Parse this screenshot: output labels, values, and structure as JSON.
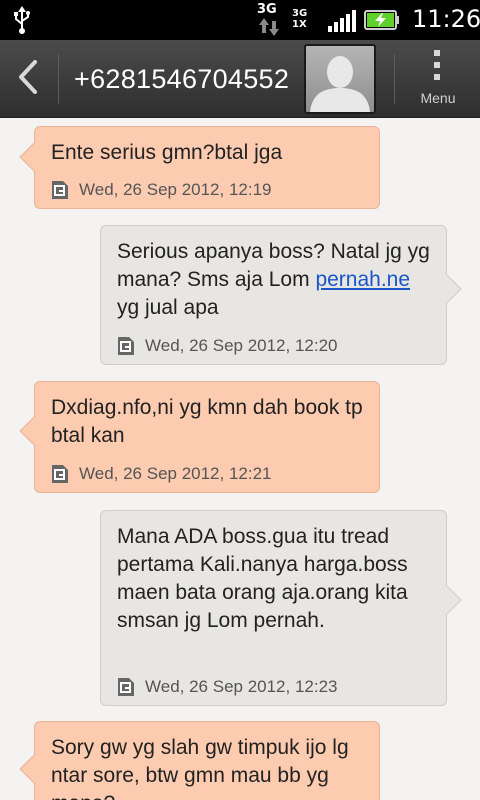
{
  "status_bar": {
    "network_3g": "3G",
    "network_type_top": "3G",
    "network_type_bottom": "1X",
    "time": "11:26"
  },
  "header": {
    "contact": "+6281546704552",
    "menu_label": "Menu"
  },
  "messages": [
    {
      "direction": "incoming",
      "text": "Ente serius gmn?btal jga",
      "time": "Wed, 26 Sep 2012, 12:19"
    },
    {
      "direction": "outgoing",
      "text_before": "Serious apanya boss? Natal jg yg mana? Sms aja Lom ",
      "link": "pernah.ne",
      "text_after": " yg jual apa",
      "time": "Wed, 26 Sep 2012, 12:20"
    },
    {
      "direction": "incoming",
      "text": "Dxdiag.nfo,ni yg kmn dah book tp btal kan",
      "time": "Wed, 26 Sep 2012, 12:21"
    },
    {
      "direction": "outgoing",
      "text": "Mana ADA boss.gua itu tread pertama Kali.nanya harga.boss maen bata orang aja.orang kita smsan jg Lom pernah.",
      "time": "Wed, 26 Sep 2012, 12:23"
    },
    {
      "direction": "incoming",
      "text": "Sory gw yg slah gw timpuk ijo lg ntar sore, btw gmn mau bb yg mana?"
    }
  ],
  "colors": {
    "incoming_bubble": "#fdccb0",
    "outgoing_bubble": "#e7e6e3",
    "link": "#1a56c8",
    "battery": "#5fd02c"
  },
  "icons": [
    "usb-icon",
    "data-arrows-icon",
    "signal-icon",
    "battery-charging-icon",
    "back-arrow-icon",
    "contact-avatar-icon",
    "menu-dots-icon",
    "sim-icon"
  ]
}
